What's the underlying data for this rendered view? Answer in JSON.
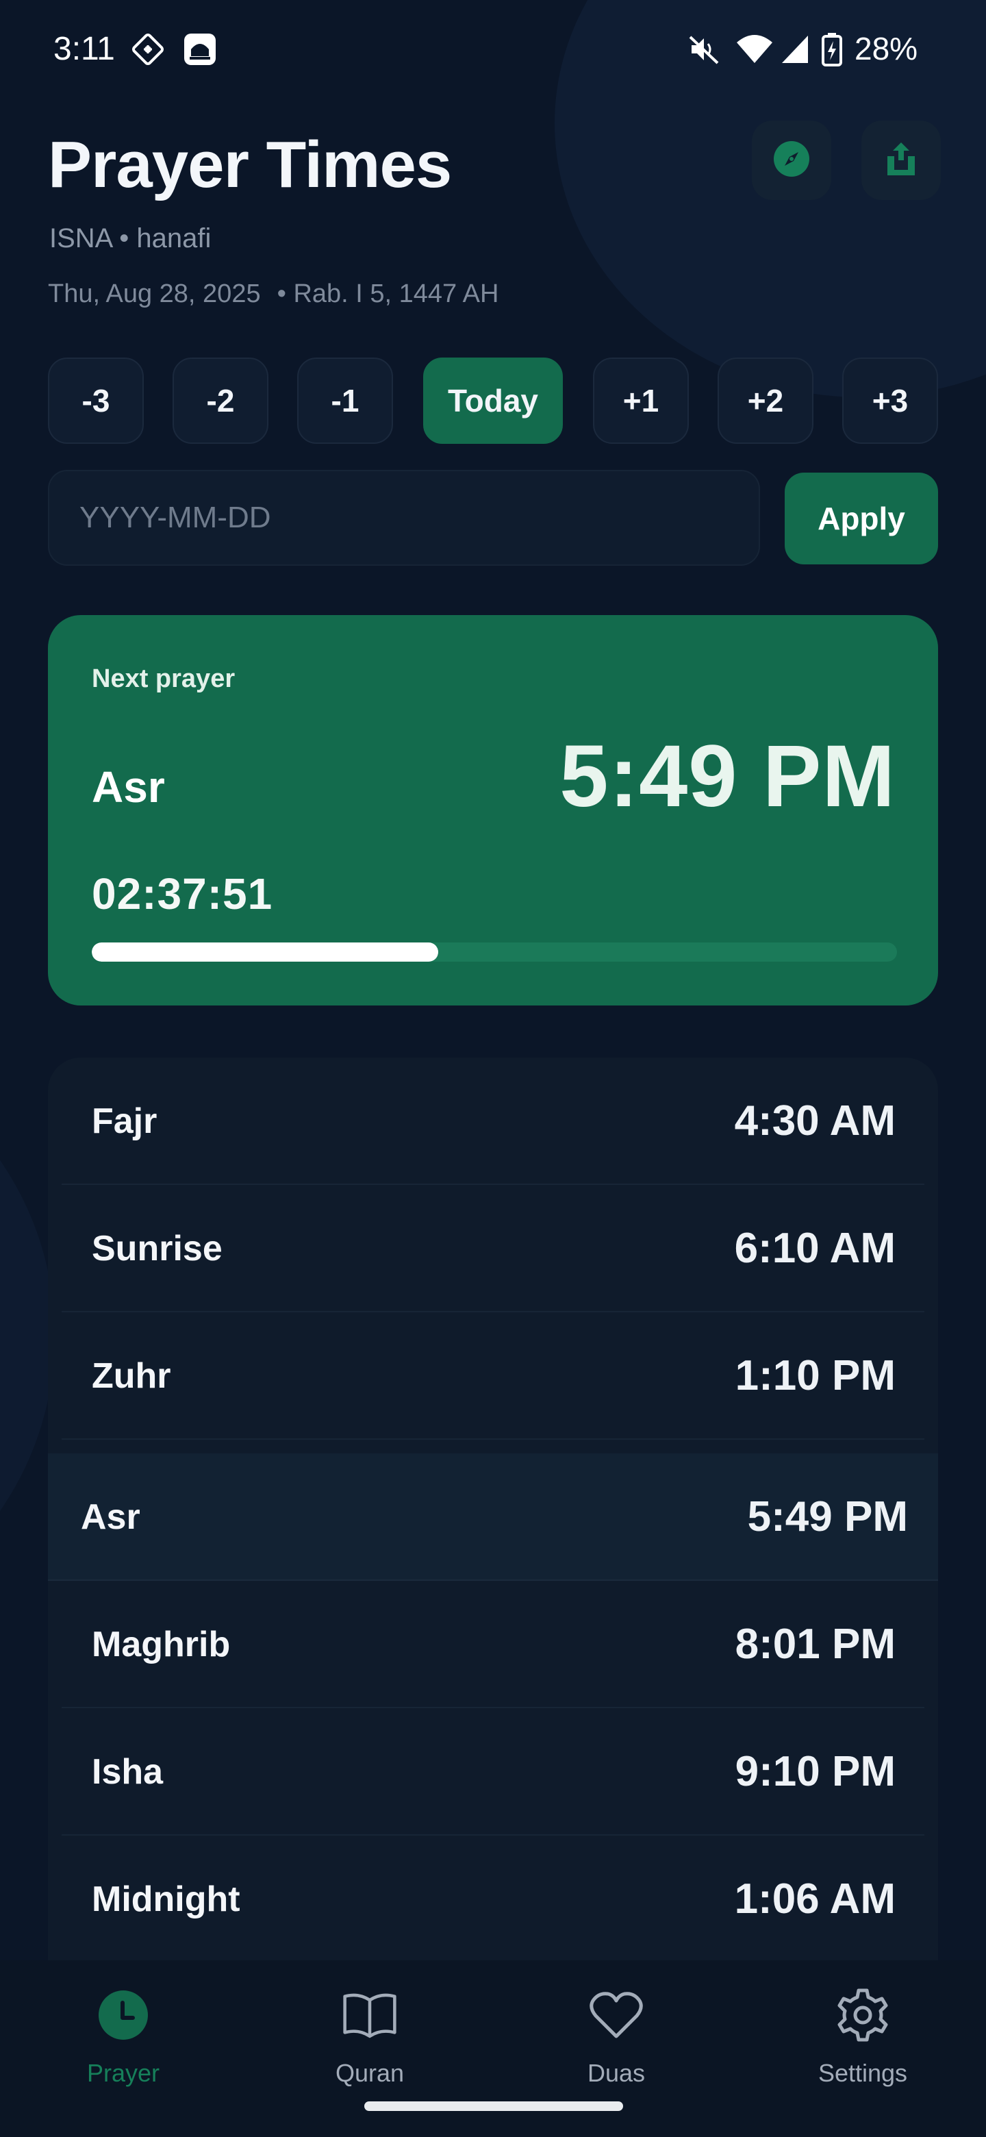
{
  "status_bar": {
    "time": "3:11",
    "battery": "28%",
    "icons": [
      "screen-record-icon",
      "mosque-app-icon",
      "mute-icon",
      "wifi-icon",
      "signal-icon",
      "battery-charging-icon"
    ]
  },
  "header": {
    "title": "Prayer Times",
    "method": "ISNA",
    "madhab": "hanafi",
    "subtitle_separator": " • ",
    "gregorian_date": "Thu, Aug 28, 2025",
    "hijri_date": "• Rab. I 5, 1447 AH",
    "actions": [
      "compass-icon",
      "share-icon"
    ]
  },
  "day_selector": {
    "days": [
      "-3",
      "-2",
      "-1",
      "Today",
      "+1",
      "+2",
      "+3"
    ],
    "selected": "Today"
  },
  "date_input": {
    "value": "",
    "placeholder": "YYYY-MM-DD",
    "apply_label": "Apply"
  },
  "next_prayer": {
    "label": "Next prayer",
    "name": "Asr",
    "time": "5:49 PM",
    "countdown": "02:37:51",
    "progress": 0.43
  },
  "prayers": [
    {
      "name": "Fajr",
      "time": "4:30 AM"
    },
    {
      "name": "Sunrise",
      "time": "6:10 AM"
    },
    {
      "name": "Zuhr",
      "time": "1:10 PM"
    },
    {
      "name": "Asr",
      "time": "5:49 PM"
    },
    {
      "name": "Maghrib",
      "time": "8:01 PM"
    },
    {
      "name": "Isha",
      "time": "9:10 PM"
    },
    {
      "name": "Midnight",
      "time": "1:06 AM"
    }
  ],
  "highlighted_prayer": "Asr",
  "bottom_nav": {
    "items": [
      {
        "label": "Prayer",
        "icon": "clock-icon",
        "active": true
      },
      {
        "label": "Quran",
        "icon": "book-icon",
        "active": false
      },
      {
        "label": "Duas",
        "icon": "heart-icon",
        "active": false
      },
      {
        "label": "Settings",
        "icon": "gear-icon",
        "active": false
      }
    ]
  },
  "colors": {
    "background": "#0b1628",
    "accent": "#136b4d",
    "card": "#0f1b2b",
    "muted_text": "#8d98a8"
  }
}
